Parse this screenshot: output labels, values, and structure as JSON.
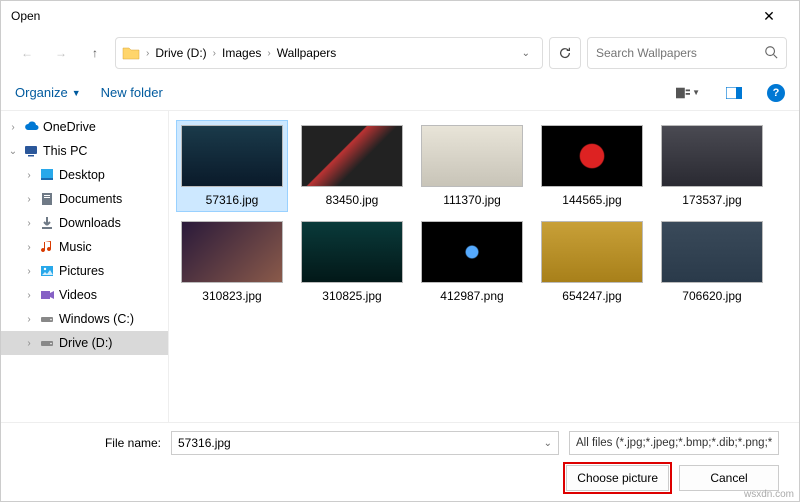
{
  "window": {
    "title": "Open"
  },
  "nav": {
    "breadcrumb": [
      "Drive (D:)",
      "Images",
      "Wallpapers"
    ]
  },
  "search": {
    "placeholder": "Search Wallpapers"
  },
  "toolbar": {
    "organize": "Organize",
    "newfolder": "New folder"
  },
  "sidebar": {
    "items": [
      {
        "label": "OneDrive",
        "chev": "›",
        "icon": "cloud",
        "color": "#0078d4"
      },
      {
        "label": "This PC",
        "chev": "⌄",
        "icon": "pc",
        "color": "#2b579a",
        "expanded": true
      },
      {
        "label": "Desktop",
        "chev": "›",
        "icon": "desktop",
        "sub": true,
        "color": "#28a8ea"
      },
      {
        "label": "Documents",
        "chev": "›",
        "icon": "doc",
        "sub": true,
        "color": "#6f7a86"
      },
      {
        "label": "Downloads",
        "chev": "›",
        "icon": "down",
        "sub": true,
        "color": "#6f7a86"
      },
      {
        "label": "Music",
        "chev": "›",
        "icon": "music",
        "sub": true,
        "color": "#d83b01"
      },
      {
        "label": "Pictures",
        "chev": "›",
        "icon": "pic",
        "sub": true,
        "color": "#28a8ea"
      },
      {
        "label": "Videos",
        "chev": "›",
        "icon": "vid",
        "sub": true,
        "color": "#8661c5"
      },
      {
        "label": "Windows (C:)",
        "chev": "›",
        "icon": "drive",
        "sub": true,
        "color": "#888"
      },
      {
        "label": "Drive (D:)",
        "chev": "›",
        "icon": "drive",
        "sub": true,
        "color": "#888",
        "sel": true
      }
    ]
  },
  "files": [
    {
      "name": "57316.jpg",
      "sel": true,
      "bg": "linear-gradient(#1a3a4a,#0a1a2a)"
    },
    {
      "name": "83450.jpg",
      "bg": "linear-gradient(135deg,#222 40%,#b33 41%,#222 60%)"
    },
    {
      "name": "111370.jpg",
      "bg": "linear-gradient(#e8e4d8,#c8c4b8)"
    },
    {
      "name": "144565.jpg",
      "bg": "radial-gradient(circle,#d22 20%,#000 22%)"
    },
    {
      "name": "173537.jpg",
      "bg": "linear-gradient(#4a4a52,#2a2a32)"
    },
    {
      "name": "310823.jpg",
      "bg": "linear-gradient(135deg,#2a1a3a,#8a5a4a)"
    },
    {
      "name": "310825.jpg",
      "bg": "linear-gradient(#0a3a3a,#021818)"
    },
    {
      "name": "412987.png",
      "bg": "radial-gradient(circle,#5af 10%,#000 12%)"
    },
    {
      "name": "654247.jpg",
      "bg": "linear-gradient(#c8a038,#a8801a)"
    },
    {
      "name": "706620.jpg",
      "bg": "linear-gradient(#3a4a5a,#2a3a4a)"
    }
  ],
  "bottom": {
    "filelabel": "File name:",
    "filename": "57316.jpg",
    "filter": "All files (*.jpg;*.jpeg;*.bmp;*.dib;*.png;*.jfif;*",
    "choose": "Choose picture",
    "cancel": "Cancel"
  },
  "watermark": "wsxdn.com"
}
